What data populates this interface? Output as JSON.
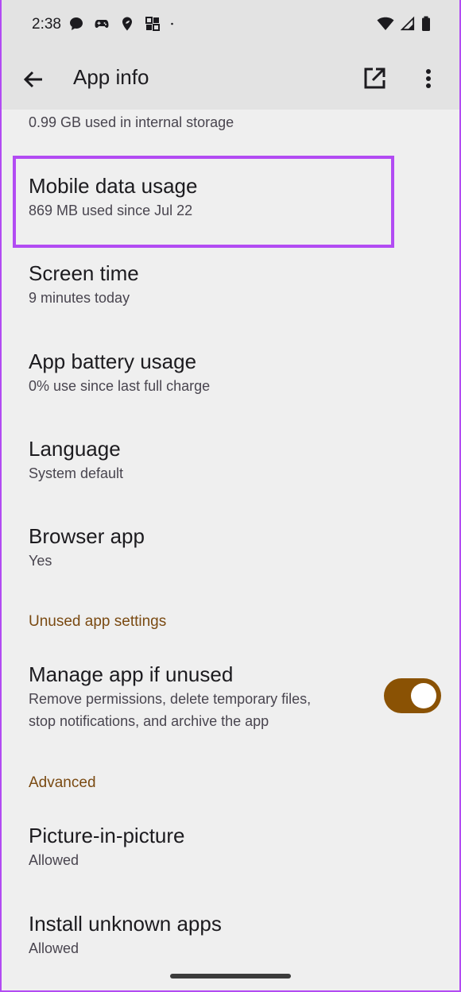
{
  "status_bar": {
    "time": "2:38",
    "left_icons": [
      "chat-bubble-icon",
      "gamepad-icon",
      "location-leaf-icon",
      "grid-apps-icon",
      "dot-icon"
    ],
    "right_icons": [
      "wifi-icon",
      "signal-icon",
      "battery-icon"
    ]
  },
  "app_bar": {
    "title": "App info",
    "back_icon": "arrow-left-icon",
    "open_icon": "open-in-new-icon",
    "more_icon": "more-vert-icon"
  },
  "storage_partial": {
    "subtitle": "0.99 GB used in internal storage"
  },
  "items": [
    {
      "title": "Mobile data usage",
      "subtitle": "869 MB used since Jul 22"
    },
    {
      "title": "Screen time",
      "subtitle": "9 minutes today"
    },
    {
      "title": "App battery usage",
      "subtitle": "0% use since last full charge"
    },
    {
      "title": "Language",
      "subtitle": "System default"
    },
    {
      "title": "Browser app",
      "subtitle": "Yes"
    }
  ],
  "unused_section": {
    "header": "Unused app settings",
    "manage": {
      "title": "Manage app if unused",
      "subtitle_line1": "Remove permissions, delete temporary files,",
      "subtitle_line2": "stop notifications, and archive the app",
      "enabled": true
    }
  },
  "advanced_section": {
    "header": "Advanced",
    "items": [
      {
        "title": "Picture-in-picture",
        "subtitle": "Allowed"
      },
      {
        "title": "Install unknown apps",
        "subtitle": "Allowed"
      }
    ]
  },
  "colors": {
    "accent_highlight": "#b24bf3",
    "toggle_on": "#8a5204",
    "section_header": "#7a4a12"
  }
}
